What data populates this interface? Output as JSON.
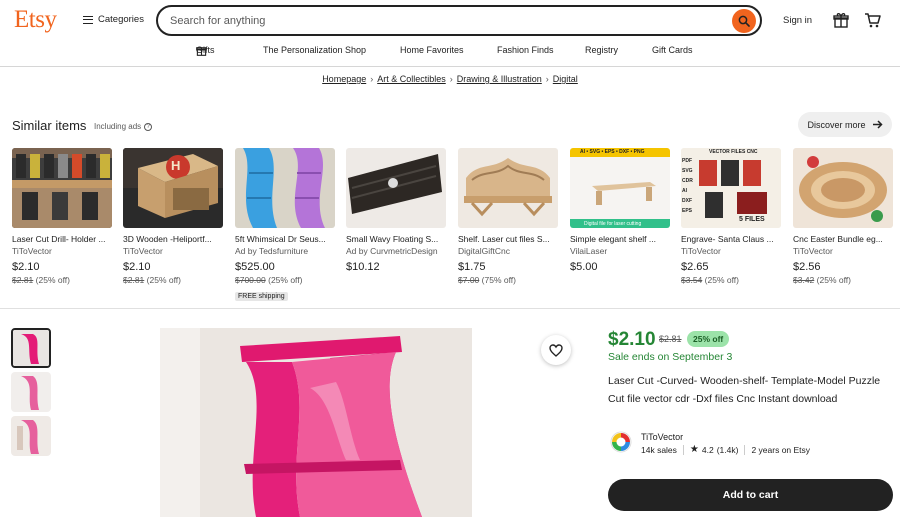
{
  "header": {
    "logo": "Etsy",
    "categories_label": "Categories",
    "search_placeholder": "Search for anything",
    "signin_label": "Sign in"
  },
  "nav": [
    "Gifts",
    "The Personalization Shop",
    "Home Favorites",
    "Fashion Finds",
    "Registry",
    "Gift Cards"
  ],
  "breadcrumb": [
    "Homepage",
    "Art & Collectibles",
    "Drawing & Illustration",
    "Digital"
  ],
  "similar": {
    "title": "Similar items",
    "subtitle": "Including ads",
    "discover_label": "Discover more",
    "items": [
      {
        "title": "Laser Cut Drill- Holder ...",
        "shop": "TiToVector",
        "price": "$2.10",
        "orig": "$2.81",
        "off": "(25% off)"
      },
      {
        "title": "3D Wooden -Heliportf...",
        "shop": "TiToVector",
        "price": "$2.10",
        "orig": "$2.81",
        "off": "(25% off)"
      },
      {
        "title": "5ft Whimsical Dr Seus...",
        "shop": "Ad by Tedsfurniture",
        "price": "$525.00",
        "orig": "$700.00",
        "off": "(25% off)",
        "badge": "FREE shipping"
      },
      {
        "title": "Small Wavy Floating S...",
        "shop": "Ad by CurvmetricDesign",
        "price": "$10.12",
        "orig": "",
        "off": ""
      },
      {
        "title": "Shelf. Laser cut files S...",
        "shop": "DigitalGiftCnc",
        "price": "$1.75",
        "orig": "$7.00",
        "off": "(75% off)"
      },
      {
        "title": "Simple elegant shelf ...",
        "shop": "VilaiLaser",
        "price": "$5.00",
        "orig": "",
        "off": ""
      },
      {
        "title": "Engrave- Santa Claus ...",
        "shop": "TiToVector",
        "price": "$2.65",
        "orig": "$3.54",
        "off": "(25% off)"
      },
      {
        "title": "Cnc Easter Bundle eg...",
        "shop": "TiToVector",
        "price": "$2.56",
        "orig": "$3.42",
        "off": "(25% off)"
      }
    ],
    "thumb_texts": {
      "heli_letter": "H",
      "simple_top": "AI • SVG • EPS • DXF • PNG",
      "simple_bottom": "Digital file for laser cutting",
      "engrave_header": "VECTOR FILES    CNC",
      "engrave_formats": [
        "PDF",
        "SVG",
        "CDR",
        "AI",
        "DXF",
        "EPS"
      ],
      "engrave_files": "5 FILES"
    }
  },
  "listing": {
    "price": "$2.10",
    "orig_price": "$2.81",
    "discount": "25% off",
    "sale_ends": "Sale ends on September 3",
    "title": "Laser Cut -Curved- Wooden-shelf- Template-Model Puzzle Cut file vector cdr -Dxf files Cnc Instant download",
    "shop_name": "TiToVector",
    "sales": "14k sales",
    "rating": "4.2",
    "reviews": "(1.4k)",
    "years": "2 years on Etsy",
    "add_to_cart": "Add to cart"
  },
  "colors": {
    "brand": "#f1641e",
    "sale_green": "#258635",
    "discount_bg": "#9ce3a9",
    "button_dark": "#222222"
  }
}
